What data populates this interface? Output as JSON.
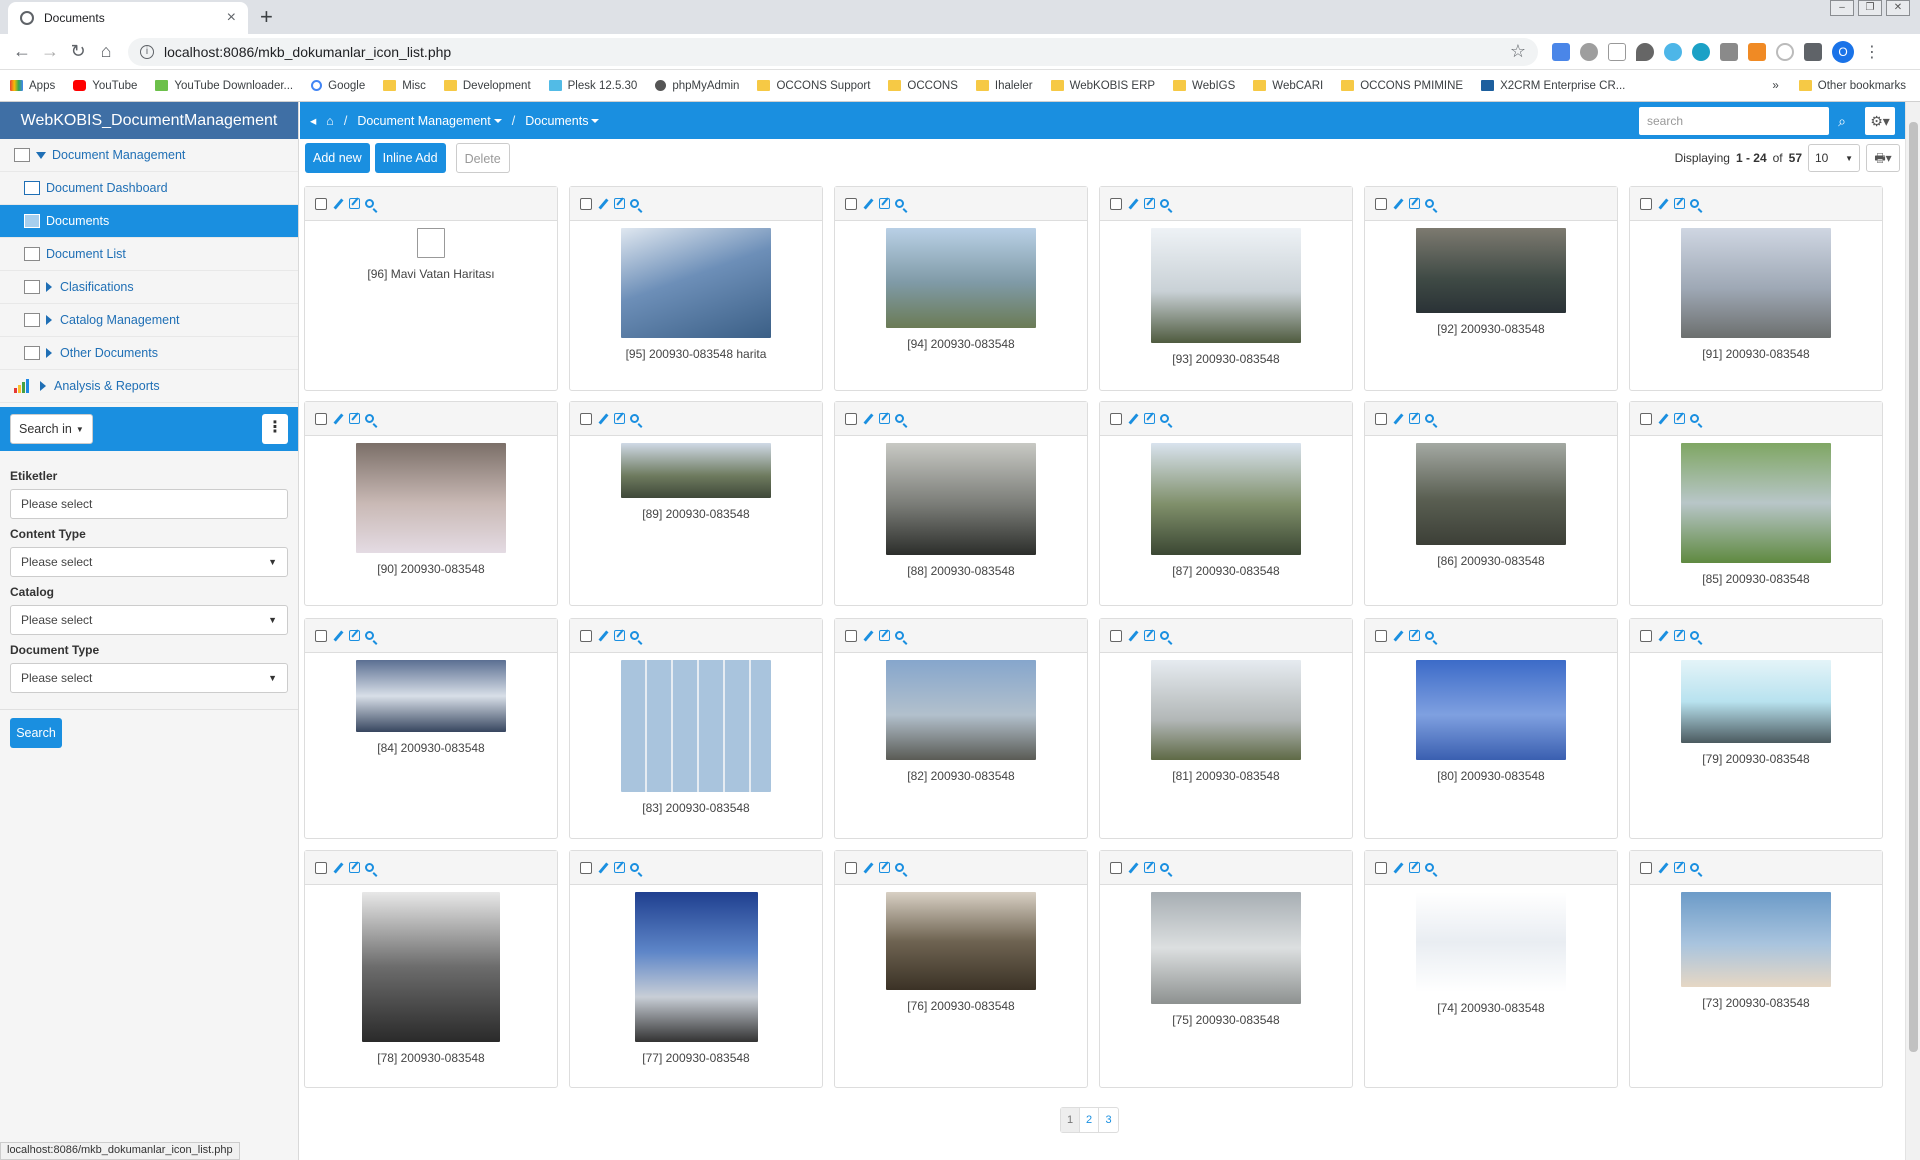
{
  "browser": {
    "tab_title": "Documents",
    "url": "localhost:8086/mkb_dokumanlar_icon_list.php",
    "profile_initial": "O",
    "bookmarks": [
      "Apps",
      "YouTube",
      "YouTube Downloader...",
      "Google",
      "Misc",
      "Development",
      "Plesk 12.5.30",
      "phpMyAdmin",
      "OCCONS Support",
      "OCCONS",
      "Ihaleler",
      "WebKOBIS ERP",
      "WebIGS",
      "WebCARI",
      "OCCONS PMIMINE",
      "X2CRM Enterprise CR..."
    ],
    "bookmarks_overflow": "»",
    "other_bookmarks": "Other bookmarks",
    "status_url": "localhost:8086/mkb_dokumanlar_icon_list.php"
  },
  "sidebar": {
    "brand": "WebKOBIS_DocumentManagement",
    "menu": {
      "root": "Document Management",
      "dashboard": "Document Dashboard",
      "documents": "Documents",
      "list": "Document List",
      "clasifications": "Clasifications",
      "catalog": "Catalog Management",
      "other": "Other Documents",
      "analysis": "Analysis & Reports"
    },
    "search_in": "Search in",
    "filters": {
      "etiketler_label": "Etiketler",
      "etiketler_value": "Please select",
      "content_type_label": "Content Type",
      "content_type_value": "Please select",
      "catalog_label": "Catalog",
      "catalog_value": "Please select",
      "doc_type_label": "Document Type",
      "doc_type_value": "Please select"
    },
    "search_button": "Search"
  },
  "topnav": {
    "breadcrumb_sep": "/",
    "crumb1": "Document Management",
    "crumb2": "Documents",
    "search_placeholder": "search"
  },
  "toolbar": {
    "add_new": "Add new",
    "inline_add": "Inline Add",
    "delete": "Delete",
    "displaying_prefix": "Displaying",
    "range": "1 - 24",
    "of_word": "of",
    "total": "57",
    "per_page": "10"
  },
  "cards": [
    {
      "caption": "[96] Mavi Vatan Haritası"
    },
    {
      "caption": "[95] 200930-083548 harita"
    },
    {
      "caption": "[94] 200930-083548"
    },
    {
      "caption": "[93] 200930-083548"
    },
    {
      "caption": "[92] 200930-083548"
    },
    {
      "caption": "[91] 200930-083548"
    },
    {
      "caption": "[90] 200930-083548"
    },
    {
      "caption": "[89] 200930-083548"
    },
    {
      "caption": "[88] 200930-083548"
    },
    {
      "caption": "[87] 200930-083548"
    },
    {
      "caption": "[86] 200930-083548"
    },
    {
      "caption": "[85] 200930-083548"
    },
    {
      "caption": "[84] 200930-083548"
    },
    {
      "caption": "[83] 200930-083548"
    },
    {
      "caption": "[82] 200930-083548"
    },
    {
      "caption": "[81] 200930-083548"
    },
    {
      "caption": "[80] 200930-083548"
    },
    {
      "caption": "[79] 200930-083548"
    },
    {
      "caption": "[78] 200930-083548"
    },
    {
      "caption": "[77] 200930-083548"
    },
    {
      "caption": "[76] 200930-083548"
    },
    {
      "caption": "[75] 200930-083548"
    },
    {
      "caption": "[74] 200930-083548"
    },
    {
      "caption": "[73] 200930-083548"
    }
  ],
  "pagination": [
    "1",
    "2",
    "3"
  ],
  "colors": {
    "accent": "#1a8fe0",
    "brand_bar": "#3f6fa5"
  }
}
